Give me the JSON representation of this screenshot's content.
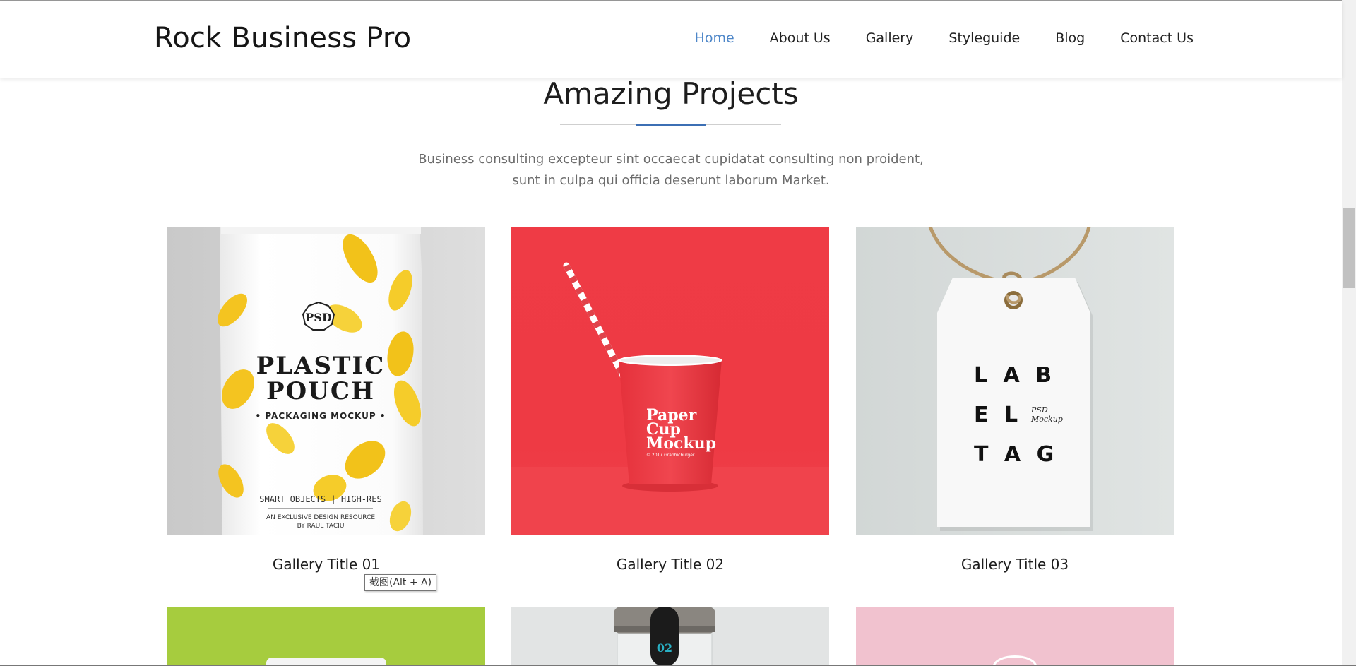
{
  "header": {
    "brand": "Rock Business Pro",
    "nav": [
      "Home",
      "About Us",
      "Gallery",
      "Styleguide",
      "Blog",
      "Contact Us"
    ],
    "active_nav": "Home",
    "accent_color": "#4d86c8"
  },
  "section": {
    "title": "Amazing Projects",
    "intro": "Business consulting excepteur sint occaecat cupidatat consulting non proident, sunt in culpa qui officia deserunt laborum Market.",
    "divider_accent_color": "#3c6fb4"
  },
  "gallery": {
    "items": [
      {
        "title": "Gallery Title 01",
        "image": {
          "psd": "PSD",
          "line1": "PLASTIC",
          "line2": "POUCH",
          "line3": "• PACKAGING MOCKUP •",
          "line4": "SMART OBJECTS | HIGH-RES",
          "line5": "AN EXCLUSIVE DESIGN RESOURCE",
          "line6": "BY RAUL TACIU"
        }
      },
      {
        "title": "Gallery Title 02",
        "image": {
          "line1": "Paper",
          "line2": "Cup",
          "line3": "Mockup",
          "line4": "© 2017 Graphicburger"
        }
      },
      {
        "title": "Gallery Title 03",
        "image": {
          "line1": "L A B",
          "line2": "E L",
          "line3": "T A G",
          "psd": "PSD",
          "mockup": "Mockup"
        }
      },
      {
        "title": "",
        "image": {}
      },
      {
        "title": "",
        "image": {
          "jar_label": "02"
        }
      },
      {
        "title": "",
        "image": {}
      }
    ]
  },
  "tooltip": {
    "text": "截图(Alt + A)"
  },
  "colors": {
    "cup_red": "#ef3b45",
    "green": "#a6cc3e",
    "pink": "#f1c2cf"
  }
}
